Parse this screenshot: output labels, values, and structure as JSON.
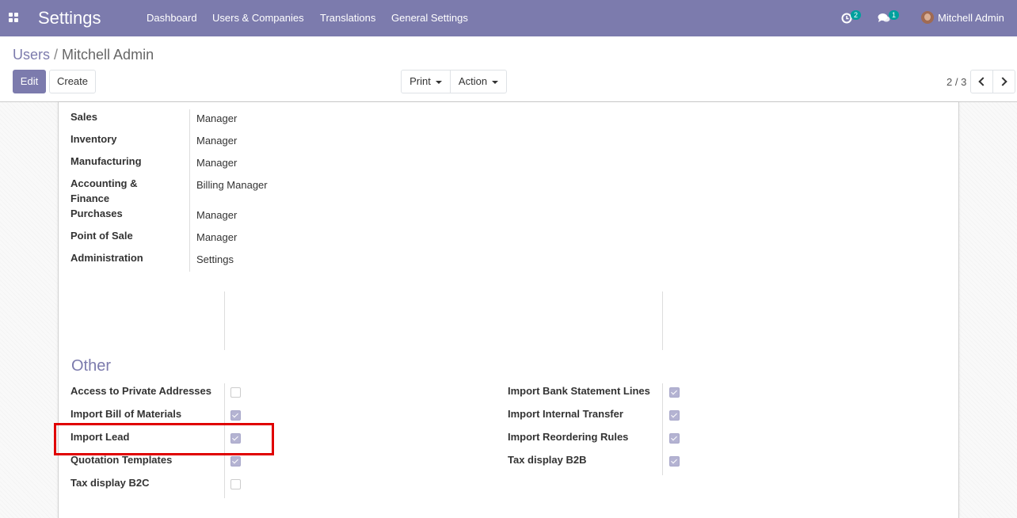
{
  "navbar": {
    "app_title": "Settings",
    "menu": [
      "Dashboard",
      "Users & Companies",
      "Translations",
      "General Settings"
    ],
    "activity_count": "2",
    "messages_count": "1",
    "user_name": "Mitchell Admin"
  },
  "breadcrumb": {
    "parent": "Users",
    "separator": "/",
    "current": "Mitchell Admin"
  },
  "buttons": {
    "edit": "Edit",
    "create": "Create",
    "print": "Print",
    "action": "Action"
  },
  "pager": {
    "value": "2 / 3"
  },
  "access_rights": [
    {
      "label": "Sales",
      "value": "Manager"
    },
    {
      "label": "Inventory",
      "value": "Manager"
    },
    {
      "label": "Manufacturing",
      "value": "Manager"
    },
    {
      "label": "Accounting &\nFinance",
      "value": "Billing Manager"
    },
    {
      "label": "Purchases",
      "value": "Manager"
    },
    {
      "label": "Point of Sale",
      "value": "Manager"
    },
    {
      "label": "Administration",
      "value": "Settings"
    }
  ],
  "other": {
    "title": "Other",
    "left": [
      {
        "label": "Access to Private Addresses",
        "checked": false
      },
      {
        "label": "Import Bill of Materials",
        "checked": true
      },
      {
        "label": "Import Lead",
        "checked": true
      },
      {
        "label": "Quotation Templates",
        "checked": true
      },
      {
        "label": "Tax display B2C",
        "checked": false
      }
    ],
    "right": [
      {
        "label": "Import Bank Statement Lines",
        "checked": true
      },
      {
        "label": "Import Internal Transfer",
        "checked": true
      },
      {
        "label": "Import Reordering Rules",
        "checked": true
      },
      {
        "label": "Tax display B2B",
        "checked": true
      }
    ]
  },
  "colors": {
    "brand": "#7c7bad",
    "highlight": "#e00000",
    "badge": "#00a09d"
  }
}
